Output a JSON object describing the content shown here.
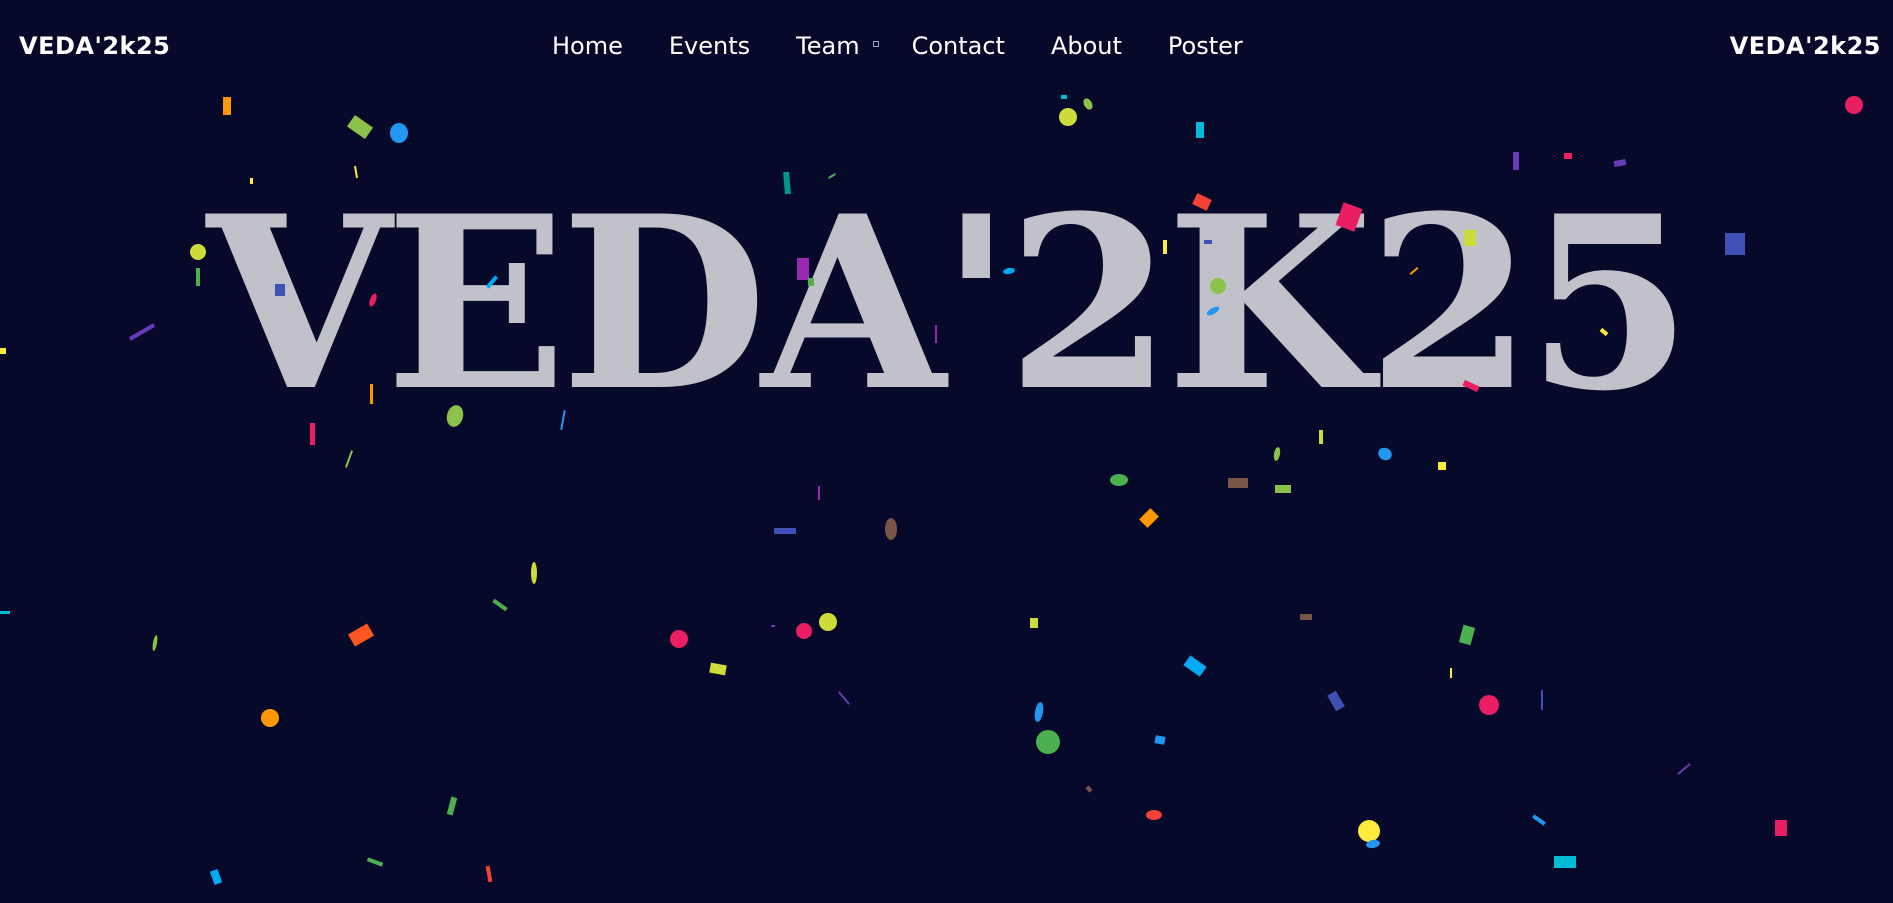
{
  "navbar": {
    "brand_left": "VEDA'2k25",
    "brand_right": "VEDA'2k25",
    "links": [
      {
        "label": "Home"
      },
      {
        "label": "Events"
      },
      {
        "label": "Team"
      },
      {
        "label": "Contact"
      },
      {
        "label": "About"
      },
      {
        "label": "Poster"
      }
    ]
  },
  "hero": {
    "title": "VEDA'2K25"
  },
  "colors": {
    "background": "#07092a",
    "title": "#c0c1c9",
    "text": "#ffffff",
    "confetti_palette": [
      "#f44336",
      "#e91e63",
      "#9c27b0",
      "#673ab7",
      "#3f51b5",
      "#2196f3",
      "#03a9f4",
      "#00bcd4",
      "#009688",
      "#4caf50",
      "#8bc34a",
      "#cddc39",
      "#ffeb3b",
      "#ff9800",
      "#ff5722",
      "#795548"
    ]
  }
}
